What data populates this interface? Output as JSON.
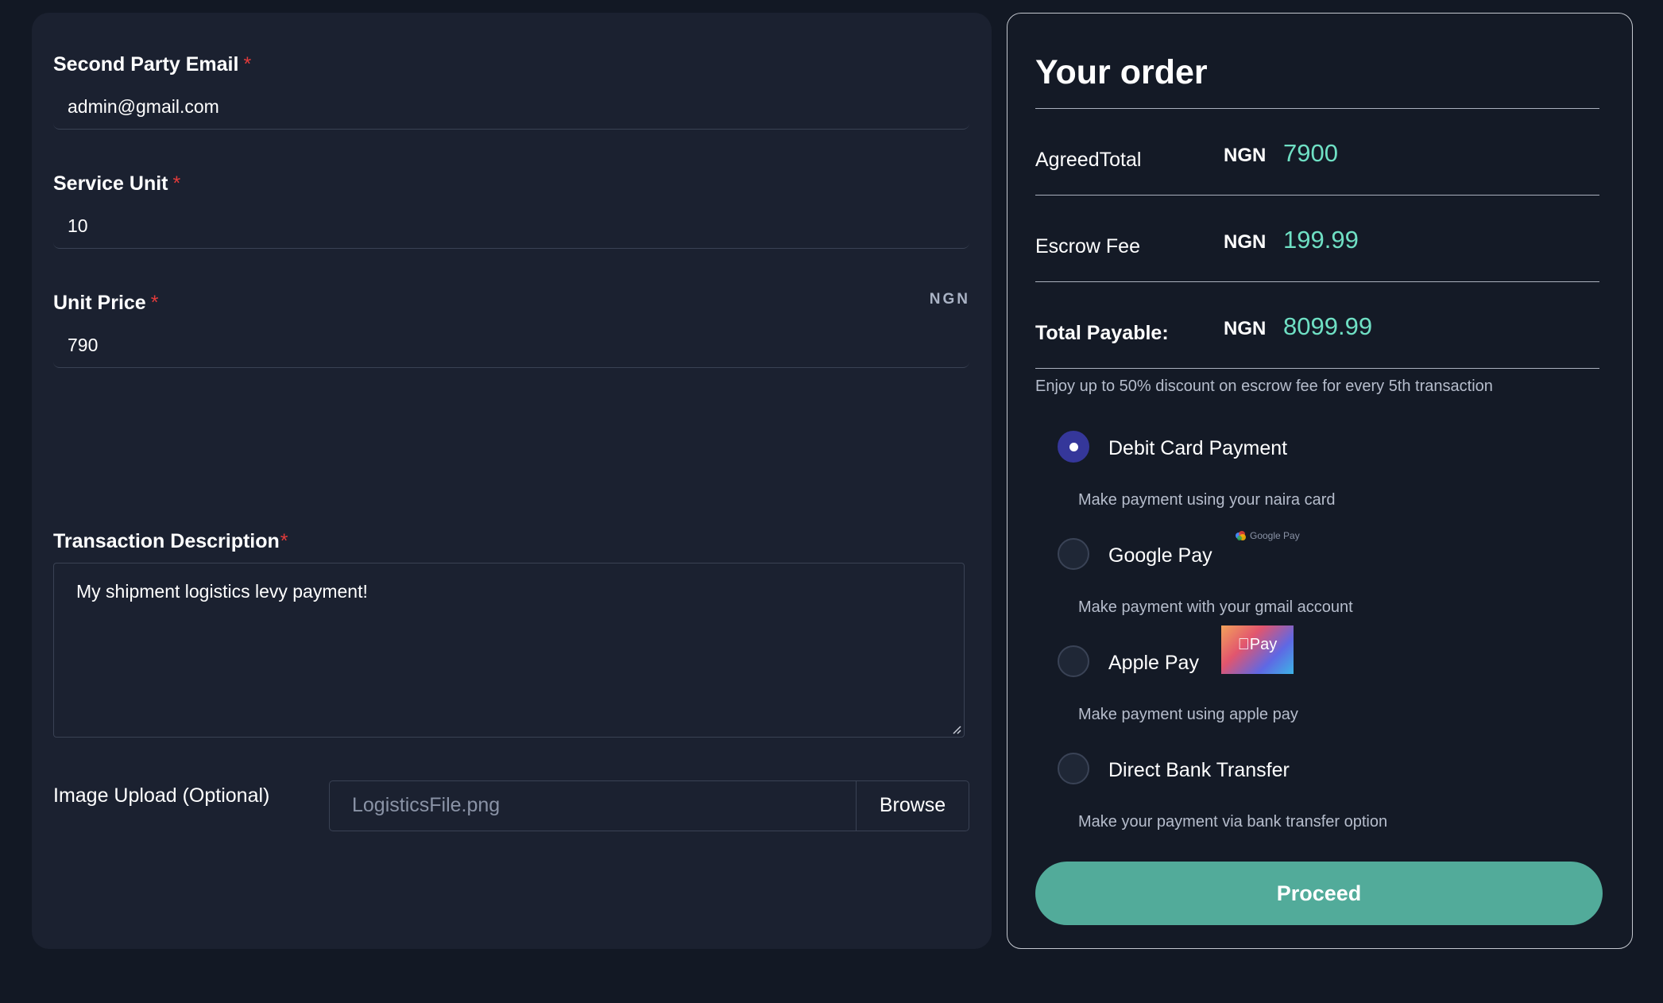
{
  "form": {
    "email": {
      "label": "Second Party Email",
      "required_mark": "*",
      "value": "admin@gmail.com"
    },
    "service_unit": {
      "label": "Service Unit",
      "required_mark": "*",
      "value": "10"
    },
    "unit_price": {
      "label": "Unit Price",
      "required_mark": "*",
      "value": "790",
      "currency": "NGN"
    },
    "description": {
      "label": "Transaction Description",
      "required_mark": "*",
      "value": "My shipment logistics levy payment!"
    },
    "upload": {
      "label": "Image Upload (Optional)",
      "file_name": "LogisticsFile.png",
      "button_label": "Browse"
    }
  },
  "order": {
    "title": "Your order",
    "rows": [
      {
        "label": "AgreedTotal",
        "currency": "NGN",
        "value": "7900"
      },
      {
        "label": "Escrow Fee",
        "currency": "NGN",
        "value": "199.99"
      },
      {
        "label": "Total Payable:",
        "currency": "NGN",
        "value": "8099.99"
      }
    ],
    "discount_note": "Enjoy up to 50% discount on escrow fee for every 5th transaction",
    "payment_methods": [
      {
        "label": "Debit Card Payment",
        "description": "Make payment using your naira card",
        "selected": true
      },
      {
        "label": "Google Pay",
        "description": "Make payment with your gmail account",
        "badge": "Google Pay",
        "selected": false
      },
      {
        "label": "Apple Pay",
        "description": "Make payment using apple pay",
        "badge": "Pay",
        "selected": false
      },
      {
        "label": "Direct Bank Transfer",
        "description": "Make your payment via bank transfer option",
        "selected": false
      }
    ],
    "proceed_label": "Proceed"
  },
  "colors": {
    "page_bg": "#121824",
    "card_bg": "#1b2130",
    "accent_value": "#6fe0c4",
    "radio_selected": "#35379a",
    "proceed_bg": "#52ab9a",
    "required": "#e23b3b"
  }
}
